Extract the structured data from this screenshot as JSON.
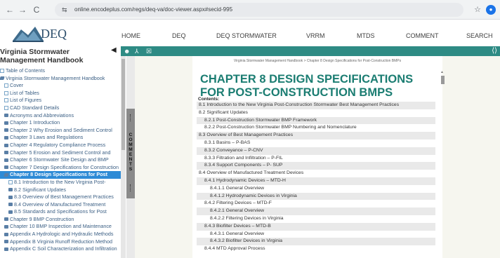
{
  "browser": {
    "back": "←",
    "forward": "→",
    "reload": "C",
    "site_info_icon": "⇆",
    "url": "online.encodeplus.com/regs/deq-va/doc-viewer.aspx#secid-995",
    "star": "☆",
    "extensions": "⬡",
    "download": "⤓",
    "profile_initial": "●"
  },
  "site": {
    "logo_text": "DEQ",
    "nav": [
      "HOME",
      "DEQ",
      "DEQ STORMWATER",
      "VRRM",
      "MTDS",
      "COMMENT",
      "SEARCH"
    ]
  },
  "toolbar": {
    "icons": [
      "☻",
      "⅄",
      "☒"
    ],
    "expand": "⟨⟩"
  },
  "sidebar": {
    "title": "Virginia Stormwater Management Handbook",
    "collapse": "◀",
    "tree": [
      {
        "label": "Table of Contents",
        "icon": "doc",
        "indent": 0
      },
      {
        "label": "Virginia Stormwater Management Handbook",
        "icon": "folder-open",
        "indent": 0
      },
      {
        "label": "Cover",
        "icon": "doc",
        "indent": 1
      },
      {
        "label": "List of Tables",
        "icon": "doc",
        "indent": 1
      },
      {
        "label": "List of Figures",
        "icon": "doc",
        "indent": 1
      },
      {
        "label": "CAD Standard Details",
        "icon": "doc",
        "indent": 1
      },
      {
        "label": "Acronyms and Abbreviations",
        "icon": "folder",
        "indent": 1
      },
      {
        "label": "Chapter 1 Introduction",
        "icon": "folder",
        "indent": 1
      },
      {
        "label": "Chapter 2 Why Erosion and Sediment Control",
        "icon": "folder",
        "indent": 1
      },
      {
        "label": "Chapter 3 Laws and Regulations",
        "icon": "folder",
        "indent": 1
      },
      {
        "label": "Chapter 4 Regulatory Compliance Process",
        "icon": "folder",
        "indent": 1
      },
      {
        "label": "Chapter 5 Erosion and Sediment Control and",
        "icon": "folder",
        "indent": 1
      },
      {
        "label": "Chapter 6 Stormwater Site Design and BMP",
        "icon": "folder",
        "indent": 1
      },
      {
        "label": "Chapter 7 Design Specifications for Construction",
        "icon": "folder",
        "indent": 1
      },
      {
        "label": "Chapter 8 Design Specifications for Post",
        "icon": "folder-open",
        "indent": 1,
        "selected": true
      },
      {
        "label": "8.1 Introduction to the New Virginia Post-",
        "icon": "doc",
        "indent": 2
      },
      {
        "label": "8.2 Significant Updates",
        "icon": "folder",
        "indent": 2
      },
      {
        "label": "8.3 Overview of Best Management Practices",
        "icon": "folder",
        "indent": 2
      },
      {
        "label": "8.4 Overview of Manufactured Treatment",
        "icon": "folder",
        "indent": 2
      },
      {
        "label": "8.5 Standards and Specifications for Post",
        "icon": "folder",
        "indent": 2
      },
      {
        "label": "Chapter 9 BMP Construction",
        "icon": "folder",
        "indent": 1
      },
      {
        "label": "Chapter 10 BMP Inspection and Maintenance",
        "icon": "folder",
        "indent": 1
      },
      {
        "label": "Appendix A Hydrologic and Hydraulic Methods",
        "icon": "folder",
        "indent": 1
      },
      {
        "label": "Appendix B Virginia Runoff Reduction Method",
        "icon": "folder",
        "indent": 1
      },
      {
        "label": "Appendix C Soil Characterization and Infiltration",
        "icon": "folder",
        "indent": 1
      }
    ]
  },
  "comments_tab": "COMMENTS",
  "document": {
    "breadcrumb": "Virginia Stormwater Management Handbook > Chapter 8 Design Specifications for Post-Construction BMPs",
    "title": "CHAPTER 8 DESIGN SPECIFICATIONS FOR POST-CONSTRUCTION BMPS",
    "contents_label": "Contents:",
    "toc": [
      {
        "label": "8.1 Introduction to the New Virginia Post-Construction Stormwater Best Management Practices",
        "level": 0
      },
      {
        "label": "8.2 Significant Updates",
        "level": 0
      },
      {
        "label": "8.2.1 Post-Construction Stormwater BMP Framework",
        "level": 1
      },
      {
        "label": "8.2.2 Post-Construction Stormwater BMP Numbering and Nomenclature",
        "level": 1
      },
      {
        "label": "8.3 Overview of Best Management Practices",
        "level": 0
      },
      {
        "label": "8.3.1 Basins – P-BAS",
        "level": 1
      },
      {
        "label": "8.3.2 Conveyance – P-CNV",
        "level": 1
      },
      {
        "label": "8.3.3 Filtration and Infiltration – P-FIL",
        "level": 1
      },
      {
        "label": "8.3.4 Support Components – P- SUP",
        "level": 1
      },
      {
        "label": "8.4 Overview of Manufactured Treatment Devices",
        "level": 0
      },
      {
        "label": "8.4.1 Hydrodynamic Devices – MTD-H",
        "level": 1
      },
      {
        "label": "8.4.1.1 General Overview",
        "level": 2
      },
      {
        "label": "8.4.1.2 Hydrodynamic Devices in Virginia",
        "level": 2
      },
      {
        "label": "8.4.2 Filtering Devices – MTD-F",
        "level": 1
      },
      {
        "label": "8.4.2.1 General Overview",
        "level": 2
      },
      {
        "label": "8.4.2.2 Filtering Devices in Virginia",
        "level": 2
      },
      {
        "label": "8.4.3 Biofilter Devices – MTD-B",
        "level": 1
      },
      {
        "label": "8.4.3.1 General Overview",
        "level": 2
      },
      {
        "label": "8.4.3.2 Biofilter Devices in Virginia",
        "level": 2
      },
      {
        "label": "8.4.4 MTD Approval Process",
        "level": 1
      }
    ]
  },
  "colors": {
    "accent_teal": "#2e8b84",
    "title_teal": "#1b7d72",
    "selected_blue": "#2e8bd6",
    "tree_link": "#3b5f84"
  }
}
